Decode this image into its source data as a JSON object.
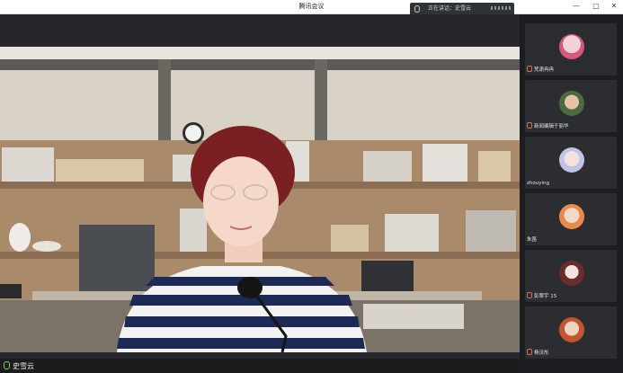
{
  "window": {
    "title": "腾讯会议",
    "speaking_indicator": "正在讲话：史雪云"
  },
  "main": {
    "self_name": "史雪云"
  },
  "participants": [
    {
      "name": "梵潇冉冉"
    },
    {
      "name": "新闻编辑于丽华"
    },
    {
      "name": "zhouying"
    },
    {
      "name": "朱笛"
    },
    {
      "name": "彭翠宇 15"
    },
    {
      "name": "杨沃彤"
    }
  ],
  "colors": {
    "titlebar": "#ffffff",
    "panel": "#1c1d20",
    "tile": "#2b2d31",
    "shirt_stripe": "#1d2a55"
  }
}
